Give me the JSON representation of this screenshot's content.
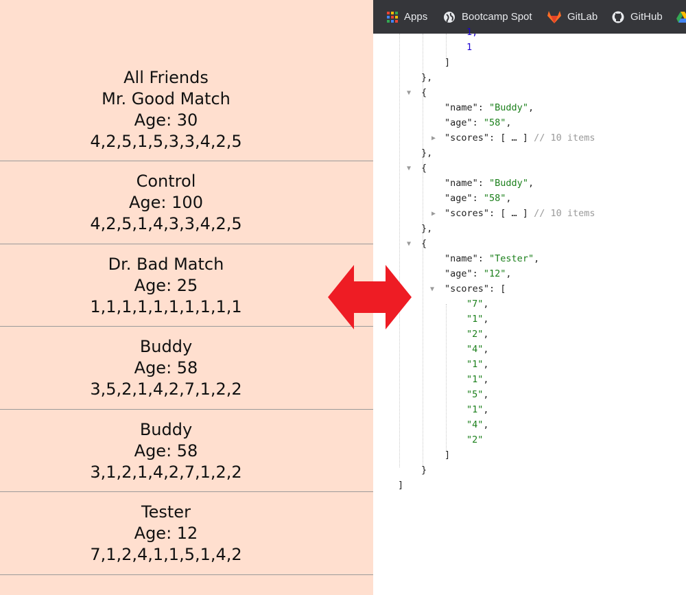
{
  "list": {
    "heading": "All Friends",
    "friends": [
      {
        "name": "Mr. Good Match",
        "age": "Age: 30",
        "scores": "4,2,5,1,5,3,3,4,2,5"
      },
      {
        "name": "Control",
        "age": "Age: 100",
        "scores": "4,2,5,1,4,3,3,4,2,5"
      },
      {
        "name": "Dr. Bad Match",
        "age": "Age: 25",
        "scores": "1,1,1,1,1,1,1,1,1,1"
      },
      {
        "name": "Buddy",
        "age": "Age: 58",
        "scores": "3,5,2,1,4,2,7,1,2,2"
      },
      {
        "name": "Buddy",
        "age": "Age: 58",
        "scores": "3,1,2,1,4,2,7,1,2,2"
      },
      {
        "name": "Tester",
        "age": "Age: 12",
        "scores": "7,1,2,4,1,1,5,1,4,2"
      }
    ]
  },
  "bookmarks": [
    {
      "label": "Apps",
      "icon": "apps-grid-icon"
    },
    {
      "label": "Bootcamp Spot",
      "icon": "globe-icon"
    },
    {
      "label": "GitLab",
      "icon": "gitlab-icon"
    },
    {
      "label": "GitHub",
      "icon": "github-icon"
    }
  ],
  "json_view": {
    "partial_top": "1,",
    "top_number": "1",
    "key_name": "\"name\"",
    "key_age": "\"age\"",
    "key_scores": "\"scores\"",
    "entries": [
      {
        "name": "\"Buddy\"",
        "age": "\"58\"",
        "collapsed_label": "[ … ]",
        "items_comment": "// 10 items"
      },
      {
        "name": "\"Buddy\"",
        "age": "\"58\"",
        "collapsed_label": "[ … ]",
        "items_comment": "// 10 items"
      },
      {
        "name": "\"Tester\"",
        "age": "\"12\"",
        "scores": [
          "\"7\"",
          "\"1\"",
          "\"2\"",
          "\"4\"",
          "\"1\"",
          "\"1\"",
          "\"5\"",
          "\"1\"",
          "\"4\"",
          "\"2\""
        ]
      }
    ]
  },
  "colors": {
    "panel_bg": "#ffdfcf",
    "arrow": "#ee1c24",
    "json_string": "#1a7f1a",
    "json_number": "#1c00cf"
  }
}
